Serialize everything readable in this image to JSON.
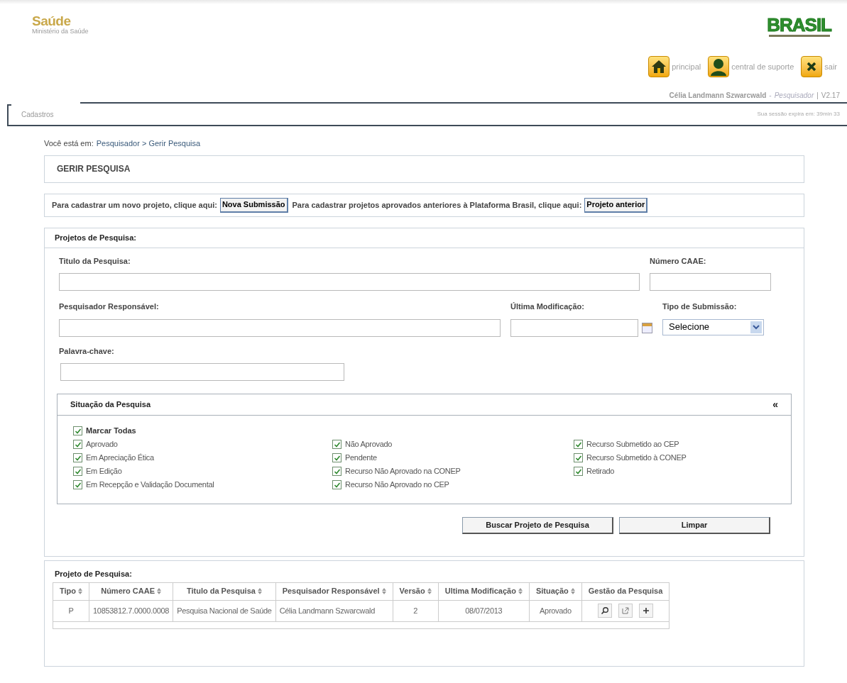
{
  "header": {
    "logo_title": "Saúde",
    "logo_subtitle": "Ministério da Saúde",
    "brand": "BRASIL",
    "nav": [
      {
        "kind": "home",
        "label": "principal"
      },
      {
        "kind": "support",
        "label": "central de suporte"
      },
      {
        "kind": "exit",
        "label": "sair"
      }
    ],
    "user": "Célia Landmann Szwarcwald",
    "role_separator": "-",
    "role": "Pesquisador",
    "version_separator": "|",
    "version": "V2.17"
  },
  "menu": {
    "tabs": [
      {
        "label": "Cadastros",
        "selected": true
      }
    ],
    "session": "Sua sessão expira em: 39min 33"
  },
  "breadcrumb": {
    "prefix": "Você está em:",
    "path": "Pesquisador > Gerir Pesquisa"
  },
  "page_title": "GERIR PESQUISA",
  "submission_bar": [
    {
      "kind": "text",
      "text": "Para cadastrar um novo projeto, clique aqui:"
    },
    {
      "kind": "button",
      "text": "Nova Submissão"
    },
    {
      "kind": "text",
      "text": "Para cadastrar projetos aprovados anteriores à Plataforma Brasil, clique aqui:"
    },
    {
      "kind": "button",
      "text": "Projeto anterior"
    }
  ],
  "search": {
    "title": "Projetos de Pesquisa:",
    "title_field": {
      "label": "Titulo da Pesquisa:"
    },
    "caae_field": {
      "label": "Número CAAE:"
    },
    "researcher_field": {
      "label": "Pesquisador Responsável:"
    },
    "modified_field": {
      "label": "Última Modificação:"
    },
    "type_field": {
      "label": "Tipo de Submissão:",
      "value": "Selecione"
    },
    "keyword_field": {
      "label": "Palavra-chave:"
    },
    "status_panel": {
      "title": "Situação da Pesquisa",
      "collapse": "«",
      "expanded": true,
      "all": {
        "label": "Marcar Todas",
        "checked": true
      },
      "columns": [
        [
          {
            "label": "Aprovado",
            "checked": true
          },
          {
            "label": "Em Apreciação Ética",
            "checked": true
          },
          {
            "label": "Em Edição",
            "checked": true
          },
          {
            "label": "Em Recepção e Validação Documental",
            "checked": true
          }
        ],
        [
          {
            "label": "Não Aprovado",
            "checked": true
          },
          {
            "label": "Pendente",
            "checked": true
          },
          {
            "label": "Recurso Não Aprovado na CONEP",
            "checked": true
          },
          {
            "label": "Recurso Não Aprovado no CEP",
            "checked": true
          }
        ],
        [
          {
            "label": "Recurso Submetido ao CEP",
            "checked": true
          },
          {
            "label": "Recurso Submetido à CONEP",
            "checked": true
          },
          {
            "label": "Retirado",
            "checked": true
          }
        ]
      ]
    },
    "buttons": [
      "Buscar Projeto de Pesquisa",
      "Limpar"
    ]
  },
  "results": {
    "title": "Projeto de Pesquisa:",
    "columns": [
      {
        "label": "Tipo",
        "sortable": true
      },
      {
        "label": "Número CAAE",
        "sortable": true
      },
      {
        "label": "Titulo da Pesquisa",
        "sortable": true
      },
      {
        "label": "Pesquisador Responsável",
        "sortable": true
      },
      {
        "label": "Versão",
        "sortable": true
      },
      {
        "label": "Ultima Modificação",
        "sortable": true
      },
      {
        "label": "Situação",
        "sortable": true
      },
      {
        "label": "Gestão da Pesquisa",
        "sortable": false
      }
    ],
    "rows": [
      {
        "cells": [
          "P",
          "10853812.7.0000.0008",
          "Pesquisa Nacional de Saúde",
          "Célia Landmann Szwarcwald",
          "2",
          "08/07/2013",
          "Aprovado"
        ],
        "actions": [
          {
            "kind": "search"
          },
          {
            "kind": "open"
          },
          {
            "kind": "add"
          }
        ]
      }
    ]
  }
}
